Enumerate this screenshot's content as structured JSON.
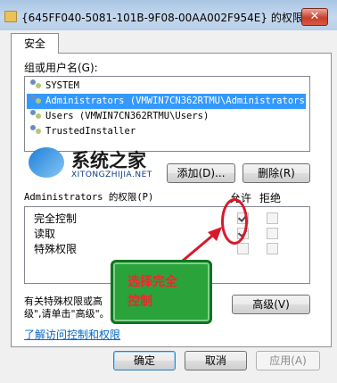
{
  "window": {
    "title": "{645FF040-5081-101B-9F08-00AA002F954E} 的权限",
    "background_text": "F645FF040-5081-101B-9F08-00AA002F954E",
    "close_symbol": "✕"
  },
  "tabs": [
    {
      "label": "安全"
    }
  ],
  "groups_section": {
    "label": "组或用户名(G):",
    "items": [
      {
        "label": "SYSTEM",
        "selected": false
      },
      {
        "label": "Administrators (VMWIN7CN362RTMU\\Administrators)",
        "selected": true
      },
      {
        "label": "Users (VMWIN7CN362RTMU\\Users)",
        "selected": false
      },
      {
        "label": "TrustedInstaller",
        "selected": false
      }
    ],
    "add_button": "添加(D)...",
    "remove_button": "删除(R)"
  },
  "watermark": {
    "text": "系统之家",
    "url": "XITONGZHIJIA.NET"
  },
  "permissions": {
    "header": "Administrators 的权限(P)",
    "allow_label": "允许",
    "deny_label": "拒绝",
    "rows": [
      {
        "name": "完全控制",
        "allow": true,
        "deny": false
      },
      {
        "name": "读取",
        "allow": true,
        "deny": false
      },
      {
        "name": "特殊权限",
        "allow": false,
        "deny": false
      }
    ]
  },
  "annotation": {
    "line1": "选择完全",
    "line2": "控制",
    "circle_color": "#d9192b",
    "callout_color": "#2aa33a"
  },
  "special_note_line1": "有关特殊权限或高",
  "special_note_line2": "级\",请单击\"高级\"。",
  "advanced_button": "高级(V)",
  "learn_link": "了解访问控制和权限",
  "footer": {
    "ok": "确定",
    "cancel": "取消",
    "apply": "应用(A)"
  }
}
